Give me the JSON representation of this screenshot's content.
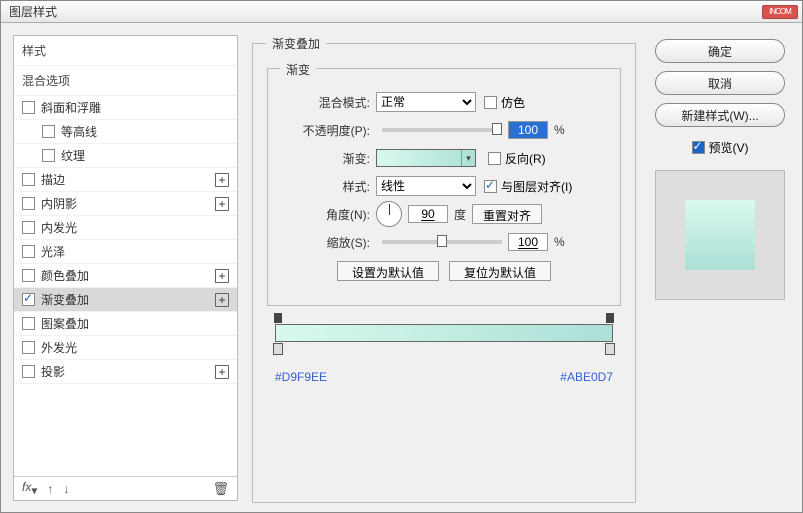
{
  "dialog": {
    "title": "图层样式"
  },
  "left": {
    "header_styles": "样式",
    "header_blend": "混合选项",
    "items": [
      {
        "label": "斜面和浮雕",
        "checked": false,
        "plus": false,
        "indent": false
      },
      {
        "label": "等高线",
        "checked": false,
        "plus": false,
        "indent": true
      },
      {
        "label": "纹理",
        "checked": false,
        "plus": false,
        "indent": true
      },
      {
        "label": "描边",
        "checked": false,
        "plus": true,
        "indent": false
      },
      {
        "label": "内阴影",
        "checked": false,
        "plus": true,
        "indent": false
      },
      {
        "label": "内发光",
        "checked": false,
        "plus": false,
        "indent": false
      },
      {
        "label": "光泽",
        "checked": false,
        "plus": false,
        "indent": false
      },
      {
        "label": "颜色叠加",
        "checked": false,
        "plus": true,
        "indent": false
      },
      {
        "label": "渐变叠加",
        "checked": true,
        "plus": true,
        "indent": false,
        "selected": true
      },
      {
        "label": "图案叠加",
        "checked": false,
        "plus": false,
        "indent": false
      },
      {
        "label": "外发光",
        "checked": false,
        "plus": false,
        "indent": false
      },
      {
        "label": "投影",
        "checked": false,
        "plus": true,
        "indent": false
      }
    ],
    "footer_fx": "fx"
  },
  "panel": {
    "title": "渐变叠加",
    "group_title": "渐变",
    "blend_mode_label": "混合模式:",
    "blend_mode_value": "正常",
    "dither_label": "仿色",
    "opacity_label": "不透明度(P):",
    "opacity_value": "100",
    "opacity_unit": "%",
    "gradient_label": "渐变:",
    "reverse_label": "反向(R)",
    "style_label": "样式:",
    "style_value": "线性",
    "align_label": "与图层对齐(I)",
    "angle_label": "角度(N):",
    "angle_value": "90",
    "angle_unit": "度",
    "reset_align": "重置对齐",
    "scale_label": "缩放(S):",
    "scale_value": "100",
    "scale_unit": "%",
    "btn_set_default": "设置为默认值",
    "btn_reset_default": "复位为默认值",
    "color_left": "#D9F9EE",
    "color_right": "#ABE0D7"
  },
  "right": {
    "ok": "确定",
    "cancel": "取消",
    "new_style": "新建样式(W)...",
    "preview": "预览(V)"
  },
  "chart_data": {
    "type": "swatch-gradient",
    "stops": [
      {
        "position": 0,
        "color": "#D9F9EE"
      },
      {
        "position": 100,
        "color": "#ABE0D7"
      }
    ],
    "angle": 90,
    "opacity": 100,
    "scale": 100,
    "style": "线性"
  }
}
